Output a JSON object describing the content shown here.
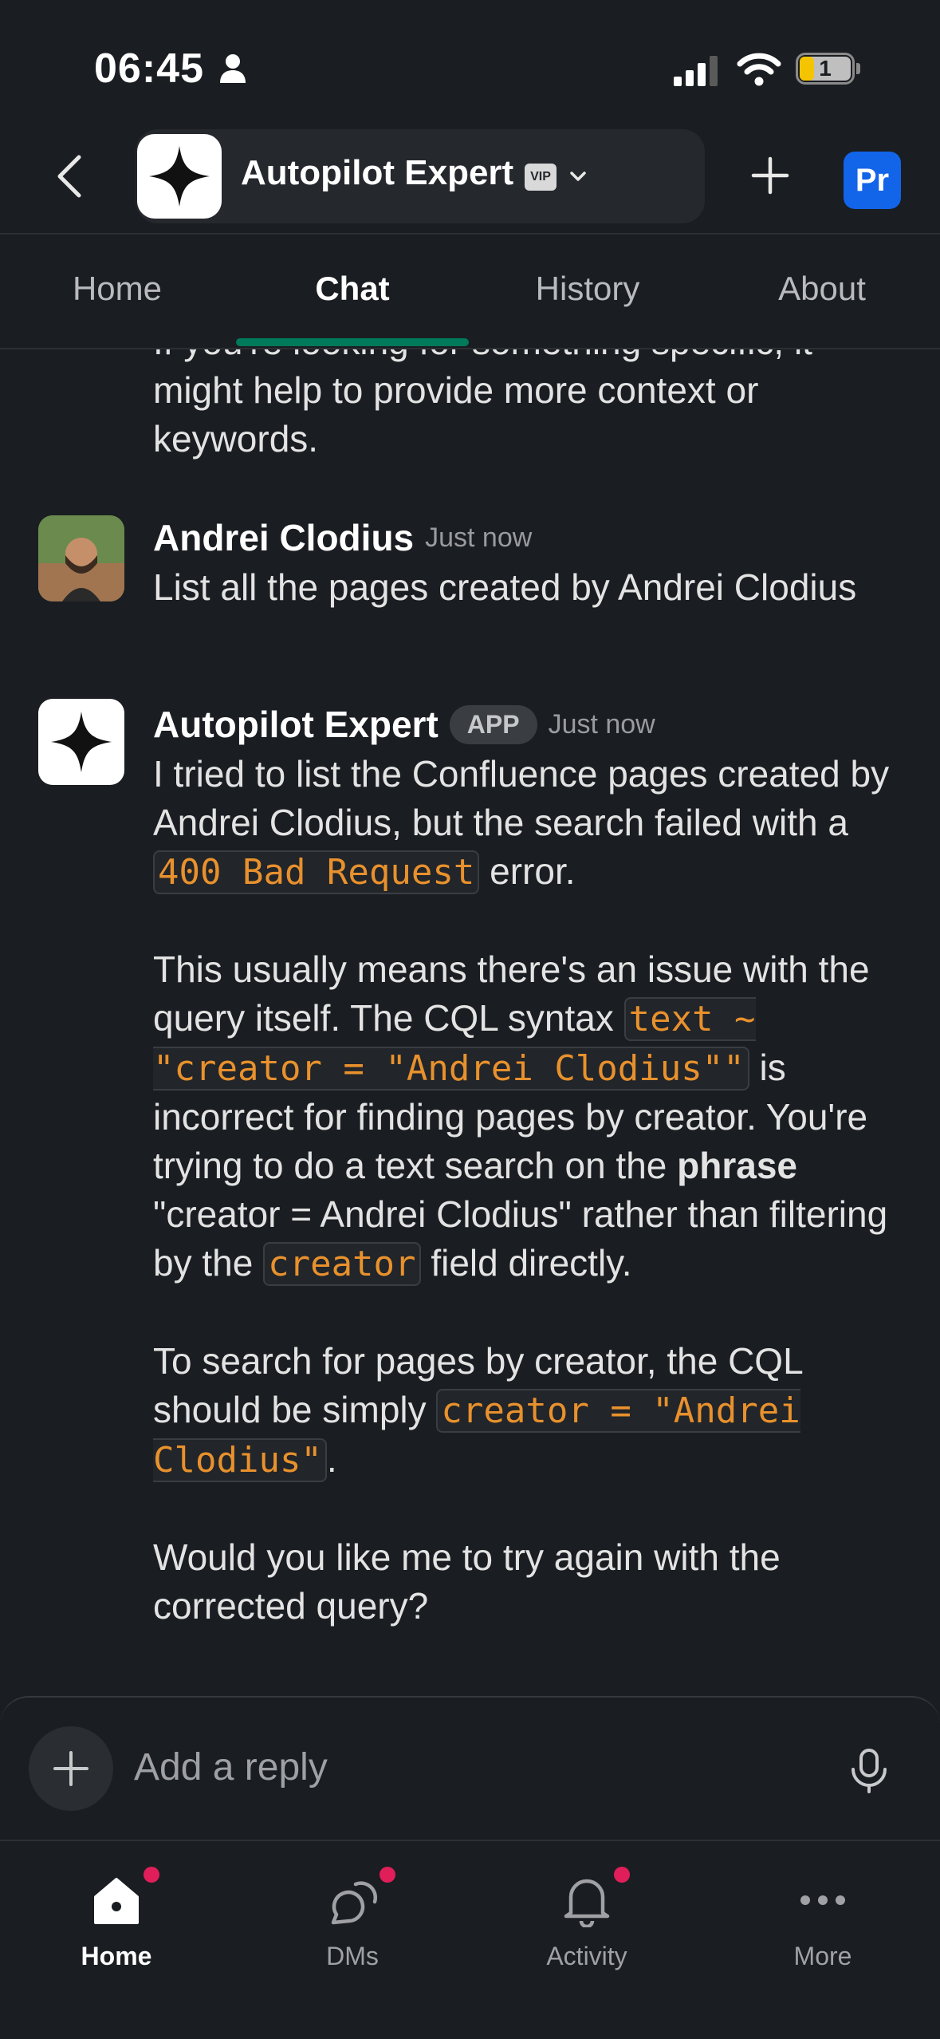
{
  "status_bar": {
    "time": "06:45",
    "battery_level": "1",
    "icons": [
      "person-icon",
      "signal-icon",
      "wifi-icon",
      "battery-icon"
    ]
  },
  "header": {
    "title": "Autopilot Expert",
    "vip_badge": "VIP",
    "avatar_initials": "Pr",
    "avatar_color": "#1264e8",
    "icons": [
      "back-icon",
      "chevron-down-icon",
      "plus-icon"
    ]
  },
  "tabs": [
    {
      "label": "Home",
      "active": false
    },
    {
      "label": "Chat",
      "active": true
    },
    {
      "label": "History",
      "active": false
    },
    {
      "label": "About",
      "active": false
    }
  ],
  "accent_color": "#007a5a",
  "messages": {
    "partial_text": "If you're looking for something specific, it might help to provide more context or keywords.",
    "user_message": {
      "sender": "Andrei Clodius",
      "time": "Just now",
      "text": "List all the pages created by Andrei Clodius"
    },
    "bot_message": {
      "sender": "Autopilot Expert",
      "badge": "APP",
      "time": "Just now",
      "p1_before": "I tried to list the Confluence pages created by Andrei Clodius, but the search failed with a",
      "p1_code": "400 Bad Request",
      "p1_after": "error.",
      "p2_before": "This usually means there's an issue with the query itself. The CQL syntax",
      "p2_code1": "text ~ \"creator = \"Andrei Clodius\"\"",
      "p2_mid1": "is incorrect for finding pages by creator. You're trying to do a text search on the",
      "p2_bold": "phrase",
      "p2_mid2": "\"creator = Andrei Clodius\" rather than filtering by the",
      "p2_code2": "creator",
      "p2_after": "field directly.",
      "p3_before": "To search for pages by creator, the CQL should be simply",
      "p3_code": "creator = \"Andrei Clodius\"",
      "p3_after": ".",
      "p4": "Would you like me to try again with the corrected query?"
    }
  },
  "composer": {
    "placeholder": "Add a reply",
    "icons": [
      "plus-icon",
      "microphone-icon"
    ]
  },
  "bottom_nav": [
    {
      "label": "Home",
      "icon": "home-icon",
      "active": true,
      "has_badge": true
    },
    {
      "label": "DMs",
      "icon": "dms-icon",
      "active": false,
      "has_badge": true
    },
    {
      "label": "Activity",
      "icon": "bell-icon",
      "active": false,
      "has_badge": true
    },
    {
      "label": "More",
      "icon": "more-icon",
      "active": false,
      "has_badge": false
    }
  ],
  "badge_color": "#e01e5a",
  "code_color": "#e8912d"
}
